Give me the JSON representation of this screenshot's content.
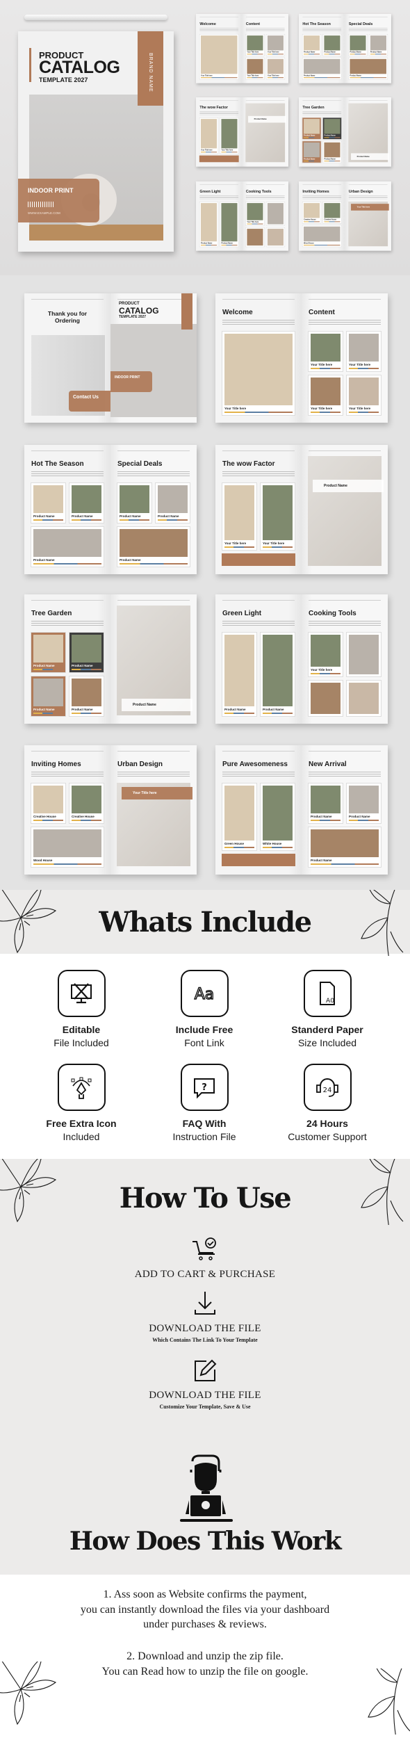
{
  "cover": {
    "line1": "PRODUCT",
    "line2": "CATALOG",
    "line3": "TEMPLATE 2027",
    "brand": "BRAND NAME",
    "band_title": "INDOOR PRINT",
    "website": "WWW.EXAMPLE.COM"
  },
  "brand_color": "#b07a58",
  "spreads": [
    {
      "left": {
        "kind": "thanks",
        "title": "Thank you for Ordering",
        "band": "Contact Us"
      },
      "right": {
        "kind": "cover"
      }
    },
    {
      "left": {
        "kind": "grid",
        "title": "Welcome",
        "cards": [
          "Your Title here"
        ]
      },
      "right": {
        "kind": "grid",
        "title": "Content",
        "cards": [
          "Your Title here",
          "Your Title here",
          "Your Title here",
          "Your Title here"
        ]
      }
    },
    {
      "left": {
        "kind": "grid",
        "title": "Hot The Season",
        "cards": [
          "Product Name",
          "Product Name",
          "Product Name"
        ]
      },
      "right": {
        "kind": "grid",
        "title": "Special Deals",
        "cards": [
          "Product Name",
          "Product Name",
          "Product Name"
        ]
      }
    },
    {
      "left": {
        "kind": "grid",
        "title": "The wow Factor",
        "cards": [
          "Your Title here",
          "Your Title here"
        ],
        "band": true
      },
      "right": {
        "kind": "photo",
        "overlay": "Product Name"
      }
    },
    {
      "left": {
        "kind": "grid",
        "title": "Tree Garden",
        "cards": [
          "Product Name",
          "Product Name",
          "Product Name",
          "Product Name"
        ],
        "styles": [
          "brown",
          "dark",
          "brown",
          "white"
        ]
      },
      "right": {
        "kind": "photo",
        "overlay": "Product Name",
        "low": true
      }
    },
    {
      "left": {
        "kind": "grid",
        "title": "Green Light",
        "cards": [
          "Product Name",
          "Product Name"
        ]
      },
      "right": {
        "kind": "grid",
        "title": "Cooking Tools",
        "cards": [
          "Your Title here",
          "",
          "",
          ""
        ]
      }
    },
    {
      "left": {
        "kind": "grid",
        "title": "Inviting Homes",
        "cards": [
          "Creative House",
          "Creative House",
          "Wood House"
        ]
      },
      "right": {
        "kind": "photo",
        "title": "Urban Design",
        "overlay": "Your Title here",
        "brown": true
      }
    },
    {
      "left": {
        "kind": "grid",
        "title": "Pure Awesomeness",
        "cards": [
          "Green House",
          "White House"
        ],
        "band": true
      },
      "right": {
        "kind": "grid",
        "title": "New Arrival",
        "cards": [
          "Product Name",
          "Product Name",
          "Product Name"
        ]
      }
    }
  ],
  "whats_include": {
    "title": "Whats Include",
    "items": [
      {
        "title": "Editable",
        "sub": "File Included",
        "icon": "design-tools-icon"
      },
      {
        "title": "Include Free",
        "sub": "Font Link",
        "icon": "font-aa-icon"
      },
      {
        "title": "Standerd Paper",
        "sub": "Size Included",
        "icon": "paper-a0-icon"
      },
      {
        "title": "Free Extra Icon",
        "sub": "Included",
        "icon": "pen-tool-icon"
      },
      {
        "title": "FAQ With",
        "sub": "Instruction File",
        "icon": "faq-chat-icon"
      },
      {
        "title": "24 Hours",
        "sub": "Customer Support",
        "icon": "support-24-icon"
      }
    ]
  },
  "how_to_use": {
    "title": "How To Use",
    "steps": [
      {
        "title": "ADD TO CART & PURCHASE",
        "sub": "",
        "icon": "cart-check-icon"
      },
      {
        "title": "DOWNLOAD THE FILE",
        "sub": "Which Contains The Link To Your Template",
        "icon": "download-icon"
      },
      {
        "title": "DOWNLOAD THE FILE",
        "sub": "Customize Your Template, Save & Use",
        "icon": "edit-icon"
      }
    ]
  },
  "how_does": {
    "title": "How Does This Work",
    "icon": "person-laptop-icon",
    "p1": [
      "1. Ass soon as Website confirms the payment,",
      "you can instantly download the files via your dashboard",
      "under purchases & reviews."
    ],
    "p2": [
      "2. Download and unzip the zip file.",
      "You can Read how to unzip the file on google."
    ]
  }
}
